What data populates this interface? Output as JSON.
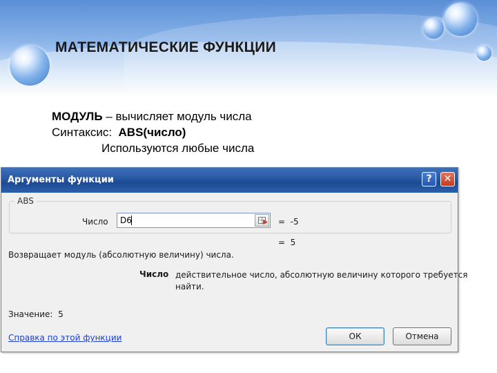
{
  "slide": {
    "title": "МАТЕМАТИЧЕСКИЕ ФУНКЦИИ",
    "line1_bold": "МОДУЛЬ",
    "line1_rest": " – вычисляет модуль числа",
    "line2_prefix": "Синтаксис:  ",
    "line2_bold": "ABS(число)",
    "line3": "Используются любые числа"
  },
  "dialog": {
    "title": "Аргументы функции",
    "help_icon": "?",
    "close_icon": "✕",
    "function_name": "ABS",
    "arg_label": "Число",
    "arg_value": "D6",
    "arg_result": "=  -5",
    "result": "=  5",
    "description": "Возвращает модуль (абсолютную величину) числа.",
    "arg_name": "Число",
    "arg_description_1": "действительное число, абсолютную величину которого требуется",
    "arg_description_2": "найти.",
    "value_line": "Значение:  5",
    "help_link": "Справка по этой функции",
    "ok_label": "ОК",
    "cancel_label": "Отмена"
  },
  "icons": {
    "help": "help-icon",
    "close": "close-icon",
    "range_select": "range-select-icon"
  },
  "colors": {
    "titlebar": "#2a5aa6",
    "close_button": "#c13b20",
    "link": "#1a3fcf"
  }
}
